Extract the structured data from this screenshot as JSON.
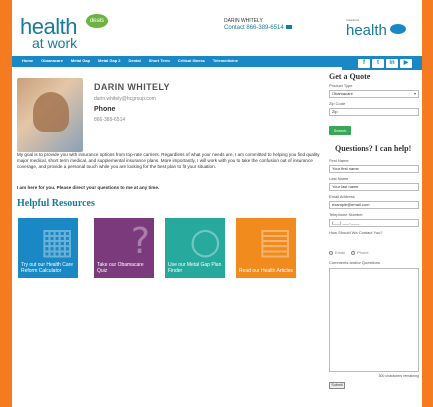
{
  "header": {
    "logo_main": "health",
    "logo_sub": "at work",
    "logo_badge": "deals",
    "contact_name": "DARIN WHITELY",
    "contact_line": "Contact 866-389-6514",
    "logo2_small": "Insurance",
    "logo2_main": "health"
  },
  "nav": {
    "items": [
      "Home",
      "Obamacare",
      "Metal Gap",
      "Metal Gap 2",
      "Dental",
      "Short Term",
      "Critical Illness",
      "Telemedicine"
    ]
  },
  "social": [
    "f",
    "t",
    "in",
    "▶"
  ],
  "agent": {
    "name": "DARIN WHITELY",
    "email": "darin.whitely@hcgroup.com",
    "phone_label": "Phone",
    "phone_value": "866-389-6514",
    "bio": "My goal is to provide you with insurance options from top-rate carriers. Regardless of what your needs are, I am committed to helping you find quality major medical, short term medical, and supplemental insurance plans. More importantly, I will work with you to take the confusion out of insurance coverage, and provide a personal touch while you are looking for the best plan to fit your situation.",
    "bio_strong": "I am here for you. Please direct your questions to me at any time."
  },
  "resources": {
    "title": "Helpful Resources",
    "tiles": [
      {
        "label": "Try out our Health Care Reform Calculator",
        "color": "#1a88c4",
        "icon": "calculator-icon",
        "glyph": "▦"
      },
      {
        "label": "Take our Obamacare Quiz",
        "color": "#7b3a7c",
        "icon": "question-icon",
        "glyph": "?"
      },
      {
        "label": "Use our Metal Gap Plan Finder",
        "color": "#27a99e",
        "icon": "magnifier-icon",
        "glyph": "○"
      },
      {
        "label": "Read our Health Articles",
        "color": "#f28b1e",
        "icon": "document-icon",
        "glyph": "▤"
      }
    ]
  },
  "quote": {
    "title": "Get a Quote",
    "product_label": "Product Type",
    "product_value": "Obamacare",
    "zip_label": "Zip Code",
    "zip_placeholder": "Zip",
    "search_label": "Search"
  },
  "help": {
    "title": "Questions? I can help!",
    "first_label": "First Name",
    "first_placeholder": "Your first name",
    "last_label": "Last Name",
    "last_placeholder": "Your last name",
    "email_label": "Email Address",
    "email_placeholder": "example@email.com",
    "phone_label": "Telephone Number",
    "phone_placeholder": "(___) ___-____",
    "contact_label": "How Should We Contact You?",
    "option_email": "Email",
    "option_phone": "Phone",
    "comments_label": "Comments and/or Questions",
    "remaining": "300 characters remaining",
    "submit_label": "Submit"
  }
}
